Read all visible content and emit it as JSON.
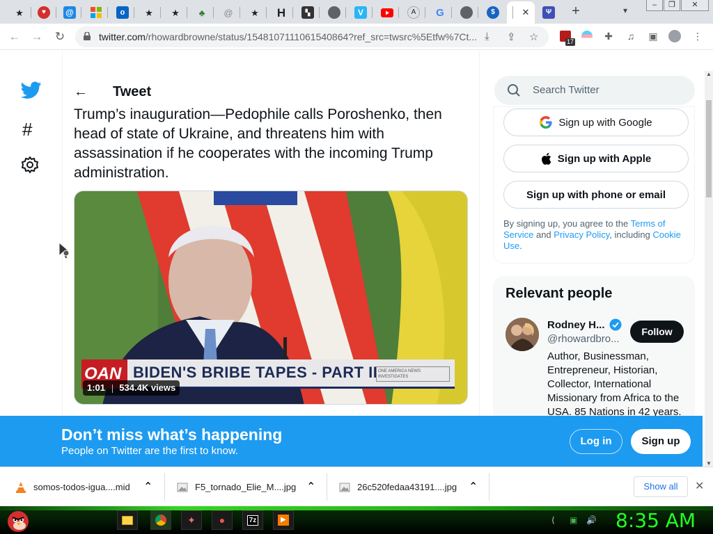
{
  "browser": {
    "tabs": [
      {
        "icon": "star-tab-icon"
      },
      {
        "icon": "shield-red-tab-icon"
      },
      {
        "icon": "at-tab-icon"
      },
      {
        "icon": "windows-tab-icon"
      },
      {
        "icon": "outlook-tab-icon"
      },
      {
        "icon": "star-tab-icon"
      },
      {
        "icon": "star-tab-icon"
      },
      {
        "icon": "leaf-tab-icon"
      },
      {
        "icon": "at-gray-tab-icon"
      },
      {
        "icon": "star-tab-icon"
      },
      {
        "icon": "h-tab-icon"
      },
      {
        "icon": "clapper-tab-icon"
      },
      {
        "icon": "globe-tab-icon"
      },
      {
        "icon": "v-tab-icon"
      },
      {
        "icon": "youtube-tab-icon"
      },
      {
        "icon": "wiki-tab-icon"
      },
      {
        "icon": "google-tab-icon"
      },
      {
        "icon": "globe-tab-icon"
      },
      {
        "icon": "blue-circle-tab-icon"
      },
      {
        "icon": "active-tab-icon"
      },
      {
        "icon": "gallery-tab-icon"
      }
    ],
    "h_glyph": "H",
    "v_glyph": "V",
    "url_host": "twitter.com",
    "url_rest": "/rhowardbrowne/status/1548107111061540864?ref_src=twsrc%5Etfw%7Ct...",
    "extension_badge": "17"
  },
  "twitter": {
    "header_title": "Tweet",
    "tweet_text": "Trump’s inauguration—Pedophile calls Poroshenko, then head of state of Ukraine, and threatens him with assassination if he cooperates with the incoming Trump administration.",
    "media": {
      "duration": "1:01",
      "views": "534.4K views",
      "channel_logo": "OAN",
      "caption": "BIDEN'S BRIBE TAPES - PART II",
      "caption_tag": "ONE AMERICA NEWS INVESTIGATES"
    },
    "search_placeholder": "Search Twitter",
    "signup": {
      "google": "Sign up with Google",
      "apple": "Sign up with Apple",
      "phone": "Sign up with phone or email",
      "legal_pre": "By signing up, you agree to the ",
      "terms": "Terms of Service",
      "legal_and": " and ",
      "privacy": "Privacy Policy",
      "legal_incl": ", including ",
      "cookie": "Cookie Use",
      "legal_end": "."
    },
    "relevant": {
      "heading": "Relevant people",
      "name": "Rodney H...",
      "handle": "@rhowardbro...",
      "follow": "Follow",
      "bio": "Author, Businessman, Entrepreneur, Historian, Collector, International Missionary from Africa to the USA. 85 Nations in 42 years."
    },
    "banner": {
      "title": "Don’t miss what’s happening",
      "subtitle": "People on Twitter are the first to know.",
      "login": "Log in",
      "signup": "Sign up"
    }
  },
  "downloads": {
    "items": [
      {
        "name": "somos-todos-igua....mid"
      },
      {
        "name": "F5_tornado_Elie_M....jpg"
      },
      {
        "name": "26c520fedaa43191....jpg"
      }
    ],
    "show_all": "Show all"
  },
  "taskbar": {
    "clock": "8:35 AM"
  },
  "colors": {
    "twitter_blue": "#1d9bf0",
    "tab_strip": "#dee1e6",
    "clock_green": "#22ff22"
  }
}
